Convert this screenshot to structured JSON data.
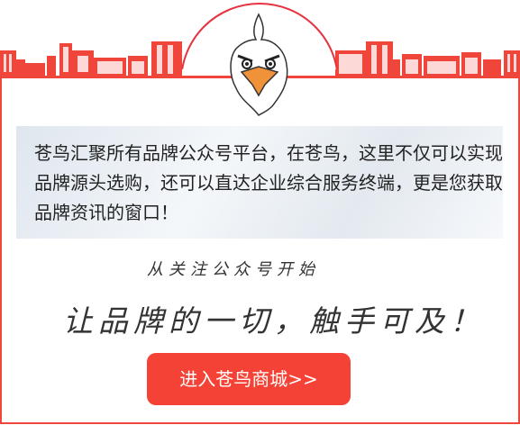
{
  "intro_text": "苍鸟汇聚所有品牌公众号平台，在苍鸟，这里不仅可以实现品牌源头选购，还可以直达企业综合服务终端，更是您获取品牌资讯的窗口！",
  "follow_text": "从关注公众号开始",
  "slogan": "让品牌的一切，触手可及！",
  "enter_button": "进入苍鸟商城>>",
  "colors": {
    "accent": "#f44336",
    "skyline": "#f0453a",
    "beak": "#f0923a"
  },
  "icons": {
    "mascot": "eagle-mascot-icon",
    "skyline": "city-skyline-icon"
  }
}
